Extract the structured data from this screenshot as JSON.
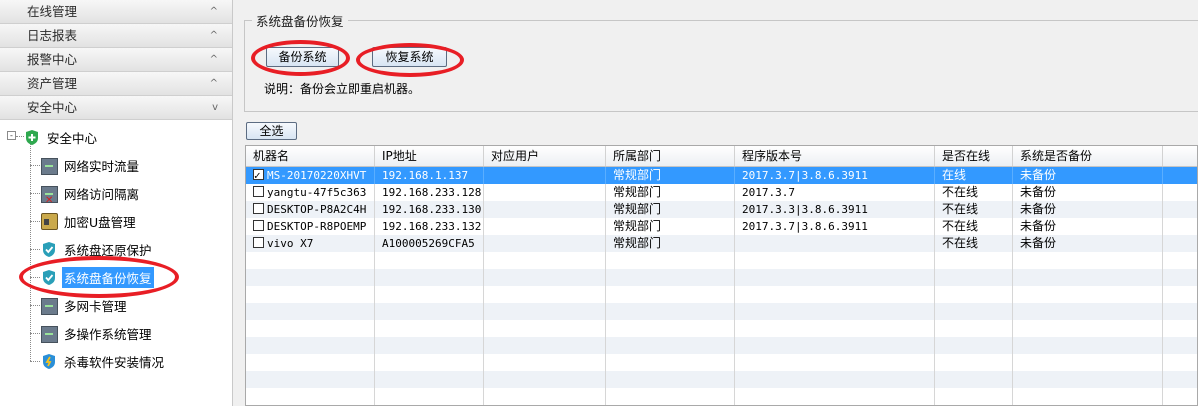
{
  "sidebar": {
    "sections": [
      {
        "label": "在线管理",
        "chevron": "^"
      },
      {
        "label": "日志报表",
        "chevron": "^"
      },
      {
        "label": "报警中心",
        "chevron": "^"
      },
      {
        "label": "资产管理",
        "chevron": "^"
      },
      {
        "label": "安全中心",
        "chevron": "v"
      }
    ],
    "tree": {
      "root": "安全中心",
      "expander": "-",
      "items": [
        {
          "label": "网络实时流量",
          "icon": "monitor-icon"
        },
        {
          "label": "网络访问隔离",
          "icon": "network-block-icon"
        },
        {
          "label": "加密U盘管理",
          "icon": "usb-lock-icon"
        },
        {
          "label": "系统盘还原保护",
          "icon": "shield-icon"
        },
        {
          "label": "系统盘备份恢复",
          "icon": "shield-icon",
          "selected": true
        },
        {
          "label": "多网卡管理",
          "icon": "monitor-icon"
        },
        {
          "label": "多操作系统管理",
          "icon": "monitor-icon"
        },
        {
          "label": "杀毒软件安装情况",
          "icon": "shield-warning-icon"
        }
      ]
    }
  },
  "backup_group": {
    "title": "系统盘备份恢复",
    "backup_button": "备份系统",
    "restore_button": "恢复系统",
    "note": "说明：备份会立即重启机器。"
  },
  "select_all_button": "全选",
  "table": {
    "columns": [
      "机器名",
      "IP地址",
      "对应用户",
      "所属部门",
      "程序版本号",
      "是否在线",
      "系统是否备份"
    ],
    "rows": [
      {
        "checked": true,
        "name": "MS-20170220XHVT",
        "ip": "192.168.1.137",
        "user": "",
        "dept": "常规部门",
        "version": "2017.3.7|3.8.6.3911",
        "online": "在线",
        "backup": "未备份",
        "selected": true
      },
      {
        "checked": false,
        "name": "yangtu-47f5c363",
        "ip": "192.168.233.128",
        "user": "",
        "dept": "常规部门",
        "version": "2017.3.7",
        "online": "不在线",
        "backup": "未备份"
      },
      {
        "checked": false,
        "name": "DESKTOP-P8A2C4H",
        "ip": "192.168.233.130",
        "user": "",
        "dept": "常规部门",
        "version": "2017.3.3|3.8.6.3911",
        "online": "不在线",
        "backup": "未备份"
      },
      {
        "checked": false,
        "name": "DESKTOP-R8POEMP",
        "ip": "192.168.233.132",
        "user": "",
        "dept": "常规部门",
        "version": "2017.3.7|3.8.6.3911",
        "online": "不在线",
        "backup": "未备份"
      },
      {
        "checked": false,
        "name": "vivo X7",
        "ip": "A100005269CFA5",
        "user": "",
        "dept": "常规部门",
        "version": "",
        "online": "不在线",
        "backup": "未备份"
      }
    ]
  },
  "colors": {
    "selection": "#3399ff",
    "highlight_ring": "#e81e25"
  }
}
